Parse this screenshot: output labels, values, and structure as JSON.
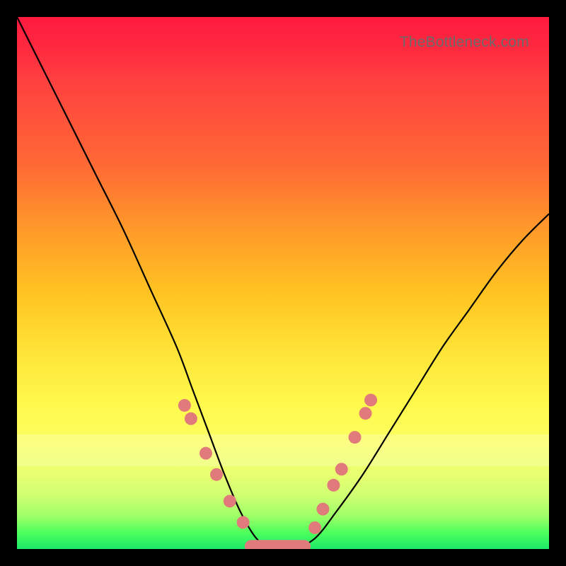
{
  "watermark": "TheBottleneck.com",
  "colors": {
    "frame": "#000000",
    "gradient_top": "#ff1a3f",
    "gradient_mid1": "#ff9a2a",
    "gradient_mid2": "#ffe136",
    "gradient_bottom": "#1de96a",
    "curve": "#000000",
    "marker": "#e17a7a"
  },
  "chart_data": {
    "type": "line",
    "title": "",
    "xlabel": "",
    "ylabel": "",
    "xlim": [
      0,
      100
    ],
    "ylim": [
      0,
      100
    ],
    "series": [
      {
        "name": "bottleneck-curve",
        "x": [
          0,
          5,
          10,
          15,
          20,
          25,
          30,
          33,
          36,
          39,
          42,
          45,
          48,
          52,
          56,
          60,
          65,
          70,
          75,
          80,
          85,
          90,
          95,
          100
        ],
        "y": [
          100,
          90,
          80,
          70,
          60,
          49,
          38,
          30,
          22,
          14,
          7,
          2,
          0,
          0,
          2,
          7,
          14,
          22,
          30,
          38,
          45,
          52,
          58,
          63
        ]
      }
    ],
    "markers_left": [
      {
        "x": 31.5,
        "y": 27
      },
      {
        "x": 32.7,
        "y": 24.5
      },
      {
        "x": 35.5,
        "y": 18
      },
      {
        "x": 37.5,
        "y": 14
      },
      {
        "x": 40.0,
        "y": 9
      },
      {
        "x": 42.5,
        "y": 5
      }
    ],
    "markers_right": [
      {
        "x": 56.0,
        "y": 4
      },
      {
        "x": 57.5,
        "y": 7.5
      },
      {
        "x": 59.5,
        "y": 12
      },
      {
        "x": 61.0,
        "y": 15
      },
      {
        "x": 63.5,
        "y": 21
      },
      {
        "x": 65.5,
        "y": 25.5
      },
      {
        "x": 66.5,
        "y": 28
      }
    ],
    "flat_bottom": {
      "x_start": 44,
      "x_end": 54,
      "y": 0.5
    }
  }
}
